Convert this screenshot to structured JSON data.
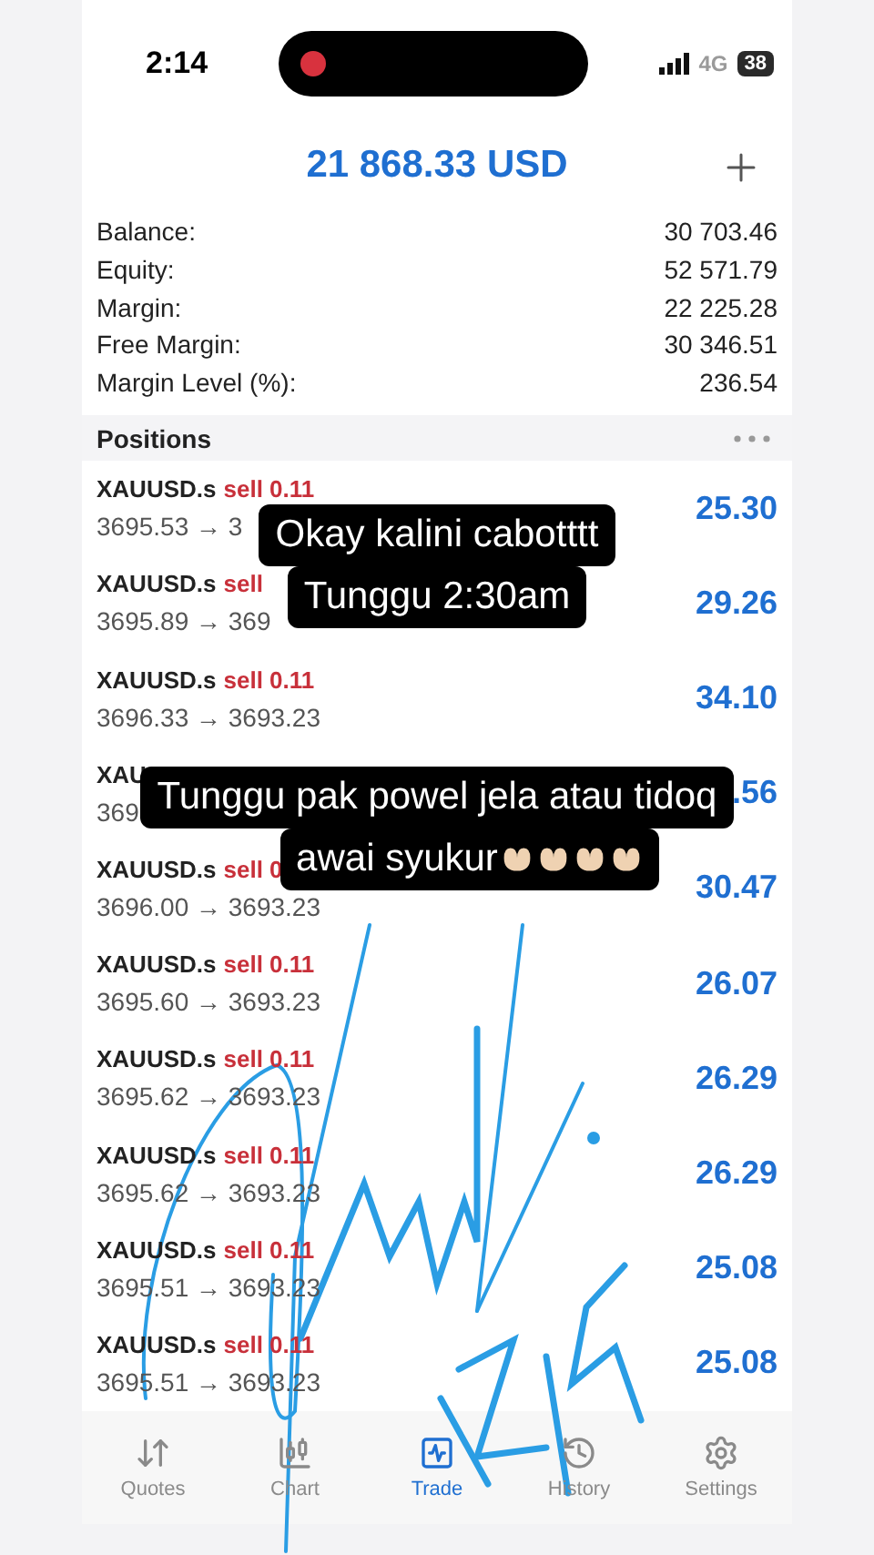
{
  "status_bar": {
    "time": "2:14",
    "network": "4G",
    "battery": "38"
  },
  "header": {
    "equity_title": "21 868.33 USD"
  },
  "account": [
    {
      "label": "Balance:",
      "value": "30 703.46"
    },
    {
      "label": "Equity:",
      "value": "52 571.79"
    },
    {
      "label": "Margin:",
      "value": "22 225.28"
    },
    {
      "label": "Free Margin:",
      "value": "30 346.51"
    },
    {
      "label": "Margin Level (%):",
      "value": "236.54"
    }
  ],
  "positions": {
    "title": "Positions",
    "rows": [
      {
        "symbol": "XAUUSD.s",
        "order": "sell 0.11",
        "prices": "3695.53 → 3",
        "profit": "25.30"
      },
      {
        "symbol": "XAUUSD.s",
        "order": "sell",
        "prices": "3695.89 → 369",
        "profit": "29.26"
      },
      {
        "symbol": "XAUUSD.s",
        "order": "sell 0.11",
        "prices": "3696.33 → 3693.23",
        "profit": "34.10"
      },
      {
        "symbol": "XAU",
        "prices": "369",
        "profit": ".56"
      },
      {
        "symbol": "XAUUSD.s",
        "order": "sell 0",
        "prices": "3696.00 → 3693.23",
        "profit": "30.47"
      },
      {
        "symbol": "XAUUSD.s",
        "order": "sell 0.11",
        "prices": "3695.60 → 3693.23",
        "profit": "26.07"
      },
      {
        "symbol": "XAUUSD.s",
        "order": "sell 0.11",
        "prices": "3695.62 → 3693.23",
        "profit": "26.29"
      },
      {
        "symbol": "XAUUSD.s",
        "order": "sell 0.11",
        "prices": "3695.62 → 3693.23",
        "profit": "26.29"
      },
      {
        "symbol": "XAUUSD.s",
        "order": "sell 0.11",
        "prices": "3695.51 → 3693.23",
        "profit": "25.08"
      },
      {
        "symbol": "XAUUSD.s",
        "order": "sell 0.11",
        "prices": "3695.51 → 3693.23",
        "profit": "25.08"
      }
    ]
  },
  "captions": [
    {
      "lines": [
        "Okay kalini cabotttt",
        "Tunggu 2:30am"
      ]
    },
    {
      "lines": [
        "Tunggu pak powel jela atau tidoq",
        "awai syukur"
      ]
    }
  ],
  "tabs": [
    {
      "label": "Quotes",
      "kind": "quotes",
      "selected": false
    },
    {
      "label": "Chart",
      "kind": "chart",
      "selected": false
    },
    {
      "label": "Trade",
      "kind": "trade",
      "selected": true
    },
    {
      "label": "History",
      "kind": "history",
      "selected": false
    },
    {
      "label": "Settings",
      "kind": "settings",
      "selected": false
    }
  ]
}
